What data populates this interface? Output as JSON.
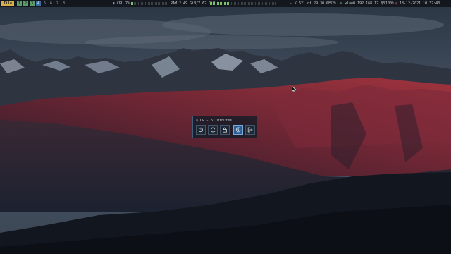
{
  "topbar": {
    "layout": "Tile",
    "workspaces": [
      {
        "label": "1",
        "state": "occupied"
      },
      {
        "label": "2",
        "state": "occupied"
      },
      {
        "label": "3",
        "state": "occupied"
      },
      {
        "label": "4",
        "state": "active"
      },
      {
        "label": "5",
        "state": "empty"
      },
      {
        "label": "6",
        "state": "empty"
      },
      {
        "label": "7",
        "state": "empty"
      },
      {
        "label": "8",
        "state": "empty"
      }
    ],
    "cpu_label": "CPU 7%",
    "cpu_level": 0.07,
    "ram_label": "RAM 2.49 GiB/7.62 GiB",
    "ram_level": 0.33,
    "disk_label": "/ 621 of 29.30 GB",
    "volume_label": "82%",
    "network_label": "wlan0 192.168.12.33",
    "battery_label": "100%",
    "datetime_label": "18-12-2021 10:32:43",
    "accent_active": "#3b6da5",
    "accent_occupied": "#5a9b6a",
    "accent_layout": "#d8b04a"
  },
  "power_menu": {
    "uptime": "UP - 51 minutes",
    "buttons": [
      {
        "name": "shutdown",
        "icon": "power-icon",
        "selected": false
      },
      {
        "name": "reboot",
        "icon": "reboot-icon",
        "selected": false
      },
      {
        "name": "lock",
        "icon": "lock-icon",
        "selected": false
      },
      {
        "name": "suspend",
        "icon": "moon-icon",
        "selected": true
      },
      {
        "name": "logout",
        "icon": "logout-icon",
        "selected": false
      }
    ]
  }
}
